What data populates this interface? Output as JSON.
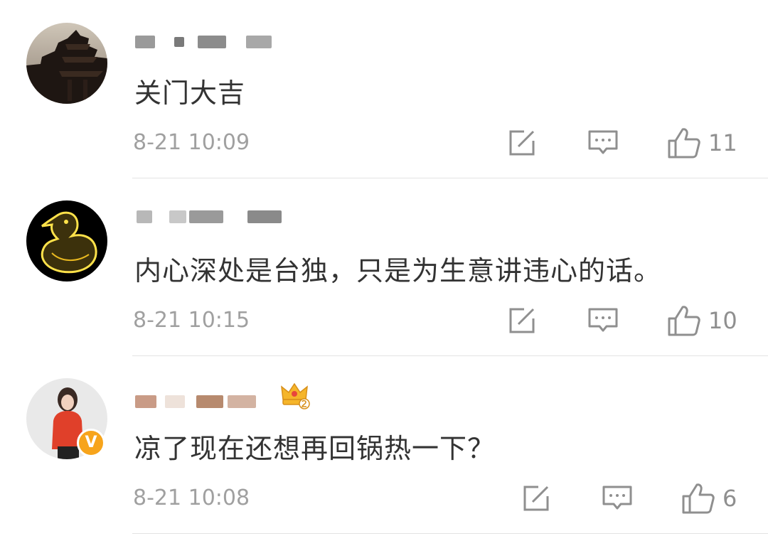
{
  "comments": [
    {
      "avatar": "pagoda-night-avatar",
      "text": "关门大吉",
      "time": "8-21 10:09",
      "likes": "11",
      "verified": false,
      "crown": false
    },
    {
      "avatar": "glowing-duck-avatar",
      "text": "内心深处是台独，只是为生意讲违心的话。",
      "time": "8-21 10:15",
      "likes": "10",
      "verified": false,
      "crown": false
    },
    {
      "avatar": "woman-red-top-avatar",
      "text": "凉了现在还想再回锅热一下？",
      "time": "8-21 10:08",
      "likes": "6",
      "verified": true,
      "crown": true
    }
  ],
  "icons": {
    "repost": "repost-icon",
    "comment": "comment-icon",
    "like": "thumbs-up-icon",
    "verified": "verified-v-icon",
    "crown": "crown-level-icon"
  },
  "colors": {
    "text": "#333333",
    "meta": "#a0a0a0",
    "icon": "#8f8f8f",
    "divider": "#e3e3e3",
    "verified": "#f7a41b"
  }
}
